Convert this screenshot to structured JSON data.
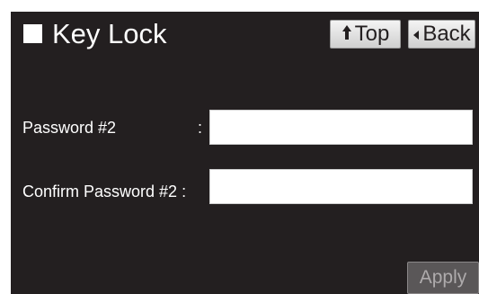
{
  "header": {
    "title": "Key Lock",
    "top_button": {
      "icon": "up-arrow-icon",
      "label": "Top"
    },
    "back_button": {
      "icon": "back-triangle-icon",
      "label": "Back"
    }
  },
  "form": {
    "password_label": "Password  #2",
    "password_colon": ":",
    "password_value": "",
    "confirm_label": "Confirm Password  #2 :",
    "confirm_value": ""
  },
  "footer": {
    "apply_label": "Apply",
    "apply_enabled": false
  },
  "colors": {
    "background": "#231f20",
    "text": "#ffffff",
    "button_face": "#e6e6e6",
    "apply_disabled_face": "#5a5758",
    "apply_disabled_text": "#aeabac"
  }
}
